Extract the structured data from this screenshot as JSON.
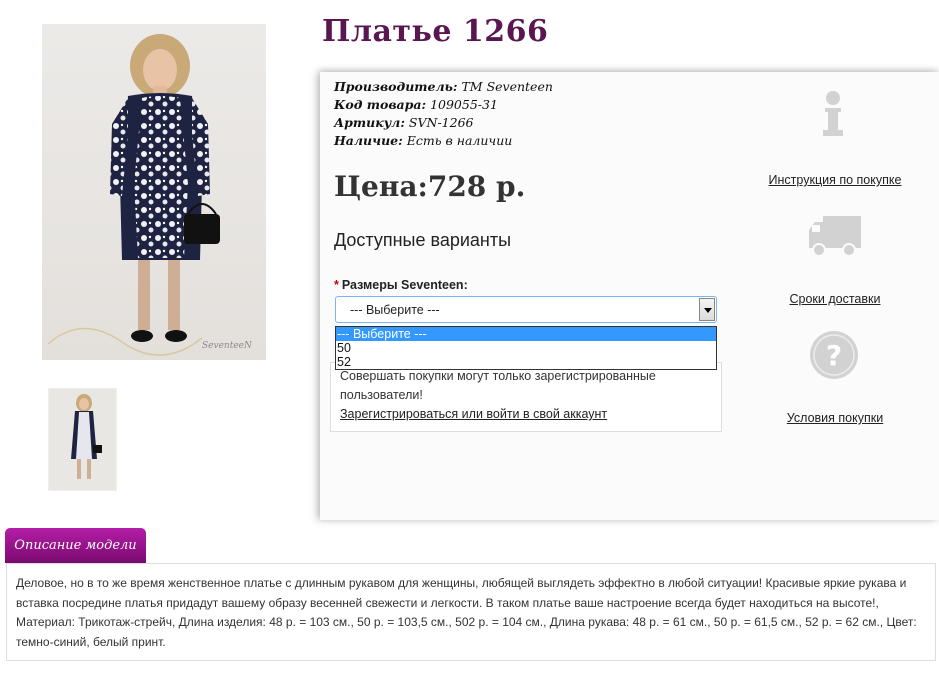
{
  "product": {
    "title": "Платье 1266",
    "photo_watermark": "SeventeeN",
    "info": {
      "manufacturer_label": "Производитель:",
      "manufacturer_value": "ТМ Seventeen",
      "code_label": "Код товара:",
      "code_value": "109055-31",
      "article_label": "Артикул:",
      "article_value": "SVN-1266",
      "availability_label": "Наличие:",
      "availability_value": "Есть в наличии"
    },
    "price_label": "Цена:",
    "price_value": "728 р.",
    "variants_heading": "Доступные варианты",
    "size_required_mark": "*",
    "size_label": "Размеры Seventeen:",
    "size_select": {
      "selected": "--- Выберите ---",
      "options": [
        "--- Выберите ---",
        "50",
        "52"
      ]
    },
    "notice": {
      "text": "Совершать покупки могут только зарегистрированные пользователи!",
      "link": "Зарегистрироваться или войти в свой аккаунт"
    }
  },
  "sidebar": {
    "purchase_instructions": "Инструкция по покупке",
    "delivery_terms": "Сроки доставки",
    "purchase_conditions": "Условия покупки",
    "icons": [
      "info-icon",
      "delivery-truck-icon",
      "question-icon"
    ],
    "icon_color": "#d2d2d2"
  },
  "description": {
    "tab_label": "Описание модели",
    "text": "Деловое, но в то же время женственное платье с длинным рукавом для женщины, любящей выглядеть эффектно в любой ситуации! Красивые яркие рукава и вставка посредине платья придадут вашему образу весенней свежести и легкости. В таком платье ваше настроение всегда будет находиться на высоте!, Материал: Трикотаж-стрейч, Длина изделия: 48 р. = 103 см., 50 р. = 103,5 см., 502 р. = 104 см., Длина рукава: 48 р. = 61 см., 50 р. = 61,5 см., 52 р. = 62 см., Цвет: темно-синий, белый принт."
  },
  "colors": {
    "title": "#5a1650",
    "tab_gradient_top": "#b41ea8",
    "tab_gradient_bottom": "#7a0a6e",
    "select_highlight": "#3399ff",
    "required": "#cc0000"
  }
}
